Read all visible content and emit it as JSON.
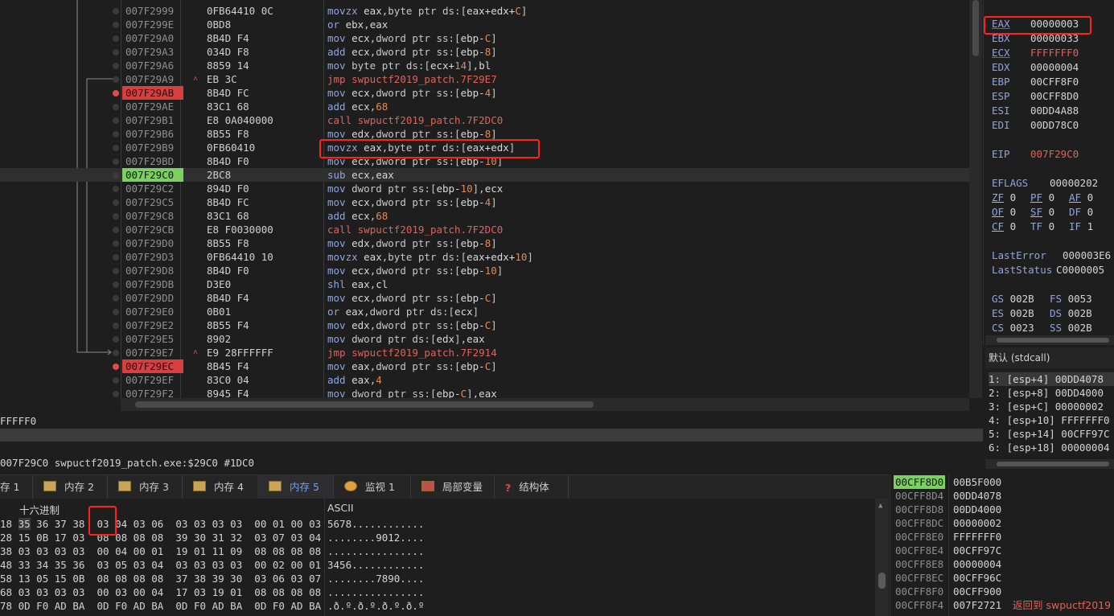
{
  "disasm": {
    "rows": [
      {
        "addr": "007F2999",
        "bytes": "0FB64410 0C",
        "mn": "movzx",
        "ops": [
          [
            "reg",
            "eax"
          ],
          [
            "t",
            ","
          ],
          [
            "t",
            "byte ptr "
          ],
          [
            "t",
            "ds:["
          ],
          [
            "reg",
            "eax+edx+"
          ],
          [
            "num",
            "C"
          ],
          [
            "t",
            "]"
          ]
        ]
      },
      {
        "addr": "007F299E",
        "bytes": "0BD8",
        "mn": "or",
        "ops": [
          [
            "reg",
            "ebx"
          ],
          [
            "t",
            ","
          ],
          [
            "reg",
            "eax"
          ]
        ]
      },
      {
        "addr": "007F29A0",
        "bytes": "8B4D F4",
        "mn": "mov",
        "ops": [
          [
            "reg",
            "ecx"
          ],
          [
            "t",
            ",dword ptr ss:["
          ],
          [
            "reg",
            "ebp-"
          ],
          [
            "num",
            "C"
          ],
          [
            "t",
            "]"
          ]
        ]
      },
      {
        "addr": "007F29A3",
        "bytes": "034D F8",
        "mn": "add",
        "ops": [
          [
            "reg",
            "ecx"
          ],
          [
            "t",
            ",dword ptr ss:["
          ],
          [
            "reg",
            "ebp-"
          ],
          [
            "num",
            "8"
          ],
          [
            "t",
            "]"
          ]
        ]
      },
      {
        "addr": "007F29A6",
        "bytes": "8859 14",
        "mn": "mov",
        "ops": [
          [
            "t",
            "byte ptr ds:["
          ],
          [
            "reg",
            "ecx+"
          ],
          [
            "num",
            "14"
          ],
          [
            "t",
            "],"
          ],
          [
            "reg",
            "bl"
          ]
        ]
      },
      {
        "addr": "007F29A9",
        "bytes": "EB 3C",
        "mn": "jmp",
        "ops": [
          [
            "call",
            "swpuctf2019_patch.7F29E7"
          ]
        ]
      },
      {
        "addr": "007F29AB",
        "bytes": "8B4D FC",
        "mn": "mov",
        "ops": [
          [
            "reg",
            "ecx"
          ],
          [
            "t",
            ",dword ptr ss:["
          ],
          [
            "reg",
            "ebp-"
          ],
          [
            "num",
            "4"
          ],
          [
            "t",
            "]"
          ]
        ]
      },
      {
        "addr": "007F29AE",
        "bytes": "83C1 68",
        "mn": "add",
        "ops": [
          [
            "reg",
            "ecx"
          ],
          [
            "t",
            ","
          ],
          [
            "num",
            "68"
          ]
        ]
      },
      {
        "addr": "007F29B1",
        "bytes": "E8 0A040000",
        "mn": "call",
        "ops": [
          [
            "call",
            "swpuctf2019_patch.7F2DC0"
          ]
        ]
      },
      {
        "addr": "007F29B6",
        "bytes": "8B55 F8",
        "mn": "mov",
        "ops": [
          [
            "reg",
            "edx"
          ],
          [
            "t",
            ",dword ptr ss:["
          ],
          [
            "reg",
            "ebp-"
          ],
          [
            "num",
            "8"
          ],
          [
            "t",
            "]"
          ]
        ]
      },
      {
        "addr": "007F29B9",
        "bytes": "0FB60410",
        "mn": "movzx",
        "ops": [
          [
            "reg",
            "eax"
          ],
          [
            "t",
            ",byte ptr ds:["
          ],
          [
            "reg",
            "eax+edx"
          ],
          [
            "t",
            "]"
          ]
        ]
      },
      {
        "addr": "007F29BD",
        "bytes": "8B4D F0",
        "mn": "mov",
        "ops": [
          [
            "reg",
            "ecx"
          ],
          [
            "t",
            ",dword ptr ss:["
          ],
          [
            "reg",
            "ebp-"
          ],
          [
            "num",
            "10"
          ],
          [
            "t",
            "]"
          ]
        ]
      },
      {
        "addr": "007F29C0",
        "bytes": "2BC8",
        "mn": "sub",
        "ops": [
          [
            "reg",
            "ecx"
          ],
          [
            "t",
            ","
          ],
          [
            "reg",
            "eax"
          ]
        ]
      },
      {
        "addr": "007F29C2",
        "bytes": "894D F0",
        "mn": "mov",
        "ops": [
          [
            "t",
            "dword ptr ss:["
          ],
          [
            "reg",
            "ebp-"
          ],
          [
            "num",
            "10"
          ],
          [
            "t",
            "],"
          ],
          [
            "reg",
            "ecx"
          ]
        ]
      },
      {
        "addr": "007F29C5",
        "bytes": "8B4D FC",
        "mn": "mov",
        "ops": [
          [
            "reg",
            "ecx"
          ],
          [
            "t",
            ",dword ptr ss:["
          ],
          [
            "reg",
            "ebp-"
          ],
          [
            "num",
            "4"
          ],
          [
            "t",
            "]"
          ]
        ]
      },
      {
        "addr": "007F29C8",
        "bytes": "83C1 68",
        "mn": "add",
        "ops": [
          [
            "reg",
            "ecx"
          ],
          [
            "t",
            ","
          ],
          [
            "num",
            "68"
          ]
        ]
      },
      {
        "addr": "007F29CB",
        "bytes": "E8 F0030000",
        "mn": "call",
        "ops": [
          [
            "call",
            "swpuctf2019_patch.7F2DC0"
          ]
        ]
      },
      {
        "addr": "007F29D0",
        "bytes": "8B55 F8",
        "mn": "mov",
        "ops": [
          [
            "reg",
            "edx"
          ],
          [
            "t",
            ",dword ptr ss:["
          ],
          [
            "reg",
            "ebp-"
          ],
          [
            "num",
            "8"
          ],
          [
            "t",
            "]"
          ]
        ]
      },
      {
        "addr": "007F29D3",
        "bytes": "0FB64410 10",
        "mn": "movzx",
        "ops": [
          [
            "reg",
            "eax"
          ],
          [
            "t",
            ",byte ptr ds:["
          ],
          [
            "reg",
            "eax+edx+"
          ],
          [
            "num",
            "10"
          ],
          [
            "t",
            "]"
          ]
        ]
      },
      {
        "addr": "007F29D8",
        "bytes": "8B4D F0",
        "mn": "mov",
        "ops": [
          [
            "reg",
            "ecx"
          ],
          [
            "t",
            ",dword ptr ss:["
          ],
          [
            "reg",
            "ebp-"
          ],
          [
            "num",
            "10"
          ],
          [
            "t",
            "]"
          ]
        ]
      },
      {
        "addr": "007F29DB",
        "bytes": "D3E0",
        "mn": "shl",
        "ops": [
          [
            "reg",
            "eax"
          ],
          [
            "t",
            ","
          ],
          [
            "reg",
            "cl"
          ]
        ]
      },
      {
        "addr": "007F29DD",
        "bytes": "8B4D F4",
        "mn": "mov",
        "ops": [
          [
            "reg",
            "ecx"
          ],
          [
            "t",
            ",dword ptr ss:["
          ],
          [
            "reg",
            "ebp-"
          ],
          [
            "num",
            "C"
          ],
          [
            "t",
            "]"
          ]
        ]
      },
      {
        "addr": "007F29E0",
        "bytes": "0B01",
        "mn": "or",
        "ops": [
          [
            "reg",
            "eax"
          ],
          [
            "t",
            ",dword ptr ds:["
          ],
          [
            "reg",
            "ecx"
          ],
          [
            "t",
            "]"
          ]
        ]
      },
      {
        "addr": "007F29E2",
        "bytes": "8B55 F4",
        "mn": "mov",
        "ops": [
          [
            "reg",
            "edx"
          ],
          [
            "t",
            ",dword ptr ss:["
          ],
          [
            "reg",
            "ebp-"
          ],
          [
            "num",
            "C"
          ],
          [
            "t",
            "]"
          ]
        ]
      },
      {
        "addr": "007F29E5",
        "bytes": "8902",
        "mn": "mov",
        "ops": [
          [
            "t",
            "dword ptr ds:["
          ],
          [
            "reg",
            "edx"
          ],
          [
            "t",
            "],"
          ],
          [
            "reg",
            "eax"
          ]
        ]
      },
      {
        "addr": "007F29E7",
        "bytes": "E9 28FFFFFF",
        "mn": "jmp",
        "ops": [
          [
            "call",
            "swpuctf2019_patch.7F2914"
          ]
        ]
      },
      {
        "addr": "007F29EC",
        "bytes": "8B45 F4",
        "mn": "mov",
        "ops": [
          [
            "reg",
            "eax"
          ],
          [
            "t",
            ",dword ptr ss:["
          ],
          [
            "reg",
            "ebp-"
          ],
          [
            "num",
            "C"
          ],
          [
            "t",
            "]"
          ]
        ]
      },
      {
        "addr": "007F29EF",
        "bytes": "83C0 04",
        "mn": "add",
        "ops": [
          [
            "reg",
            "eax"
          ],
          [
            "t",
            ","
          ],
          [
            "num",
            "4"
          ]
        ]
      },
      {
        "addr": "007F29F2",
        "bytes": "8945 F4",
        "mn": "mov",
        "ops": [
          [
            "t",
            "dword ptr ss:["
          ],
          [
            "reg",
            "ebp-"
          ],
          [
            "num",
            "C"
          ],
          [
            "t",
            "],"
          ],
          [
            "reg",
            "eax"
          ]
        ]
      }
    ]
  },
  "registers": {
    "gp": [
      {
        "name": "EAX",
        "value": "00000003",
        "underline": true,
        "changed": false
      },
      {
        "name": "EBX",
        "value": "00000033",
        "underline": false,
        "changed": false
      },
      {
        "name": "ECX",
        "value": "FFFFFFF0",
        "underline": true,
        "changed": true
      },
      {
        "name": "EDX",
        "value": "00000004",
        "underline": false,
        "changed": false
      },
      {
        "name": "EBP",
        "value": "00CFF8F0",
        "underline": false,
        "changed": false
      },
      {
        "name": "ESP",
        "value": "00CFF8D0",
        "underline": false,
        "changed": false
      },
      {
        "name": "ESI",
        "value": "00DD4A88",
        "underline": false,
        "changed": false
      },
      {
        "name": "EDI",
        "value": "00DD78C0",
        "underline": false,
        "changed": false
      }
    ],
    "eip": {
      "name": "EIP",
      "value": "007F29C0"
    },
    "eflags": {
      "name": "EFLAGS",
      "value": "00000202"
    },
    "flags": [
      [
        {
          "n": "ZF",
          "v": "0",
          "u": true
        },
        {
          "n": "PF",
          "v": "0",
          "u": true
        },
        {
          "n": "AF",
          "v": "0",
          "u": true
        }
      ],
      [
        {
          "n": "OF",
          "v": "0",
          "u": true
        },
        {
          "n": "SF",
          "v": "0",
          "u": true
        },
        {
          "n": "DF",
          "v": "0",
          "u": false
        }
      ],
      [
        {
          "n": "CF",
          "v": "0",
          "u": true
        },
        {
          "n": "TF",
          "v": "0",
          "u": false
        },
        {
          "n": "IF",
          "v": "1",
          "u": false
        }
      ]
    ],
    "last_error": {
      "name": "LastError",
      "value": "000003E6"
    },
    "last_status": {
      "name": "LastStatus",
      "value": "C0000005"
    },
    "segs": [
      [
        {
          "n": "GS",
          "v": "002B"
        },
        {
          "n": "FS",
          "v": "0053"
        }
      ],
      [
        {
          "n": "ES",
          "v": "002B"
        },
        {
          "n": "DS",
          "v": "002B"
        }
      ],
      [
        {
          "n": "CS",
          "v": "0023"
        },
        {
          "n": "SS",
          "v": "002B"
        }
      ]
    ]
  },
  "callconv": {
    "label": "默认 (stdcall)"
  },
  "stack_args": [
    "1: [esp+4] 00DD4078",
    "2: [esp+8] 00DD4000",
    "3: [esp+C] 00000002",
    "4: [esp+10] FFFFFFF0",
    "5: [esp+14] 00CFF97C",
    "6: [esp+18] 00000004"
  ],
  "infobar": {
    "line1": "FFFFF0",
    "line2": "007F29C0 swpuctf2019_patch.exe:$29C0 #1DC0"
  },
  "tabs": [
    {
      "label": "存 1",
      "icon": "memory-icon",
      "active": false
    },
    {
      "label": "内存 2",
      "icon": "memory-icon",
      "active": false
    },
    {
      "label": "内存 3",
      "icon": "memory-icon",
      "active": false
    },
    {
      "label": "内存 4",
      "icon": "memory-icon",
      "active": false
    },
    {
      "label": "内存 5",
      "icon": "memory-icon",
      "active": true
    },
    {
      "label": "监视 1",
      "icon": "watch-icon",
      "active": false
    },
    {
      "label": "局部变量",
      "icon": "locals-icon",
      "active": false
    },
    {
      "label": "结构体",
      "icon": "struct-icon",
      "active": false
    }
  ],
  "dump": {
    "hex_header": "十六进制",
    "ascii_header": "ASCII",
    "rows": [
      {
        "addr": "18",
        "hex": "35 36 37 38 03 04 03 06 03 03 03 03 00 01 00 03",
        "ascii": "5678............"
      },
      {
        "addr": "28",
        "hex": "15 0B 17 03 08 08 08 08 39 30 31 32 03 07 03 04",
        "ascii": "........9012...."
      },
      {
        "addr": "38",
        "hex": "03 03 03 03 00 04 00 01 19 01 11 09 08 08 08 08",
        "ascii": "................"
      },
      {
        "addr": "48",
        "hex": "33 34 35 36 03 05 03 04 03 03 03 03 00 02 00 01",
        "ascii": "3456............"
      },
      {
        "addr": "58",
        "hex": "13 05 15 0B 08 08 08 08 37 38 39 30 03 06 03 07",
        "ascii": "........7890...."
      },
      {
        "addr": "68",
        "hex": "03 03 03 03 00 03 00 04 17 03 19 01 08 08 08 08",
        "ascii": "................"
      },
      {
        "addr": "78",
        "hex": "0D F0 AD BA 0D F0 AD BA 0D F0 AD BA 0D F0 AD BA",
        "ascii": ".ð.º.ð.º.ð.º.ð.º"
      }
    ]
  },
  "stack": {
    "rows": [
      {
        "addr": "00CFF8D0",
        "val": "00B5F000",
        "comment": "",
        "top": true
      },
      {
        "addr": "00CFF8D4",
        "val": "00DD4078",
        "comment": "",
        "top": false
      },
      {
        "addr": "00CFF8D8",
        "val": "00DD4000",
        "comment": "",
        "top": false
      },
      {
        "addr": "00CFF8DC",
        "val": "00000002",
        "comment": "",
        "top": false
      },
      {
        "addr": "00CFF8E0",
        "val": "FFFFFFF0",
        "comment": "",
        "top": false
      },
      {
        "addr": "00CFF8E4",
        "val": "00CFF97C",
        "comment": "",
        "top": false
      },
      {
        "addr": "00CFF8E8",
        "val": "00000004",
        "comment": "",
        "top": false
      },
      {
        "addr": "00CFF8EC",
        "val": "00CFF96C",
        "comment": "",
        "top": false
      },
      {
        "addr": "00CFF8F0",
        "val": "00CFF900",
        "comment": "",
        "top": false
      },
      {
        "addr": "00CFF8F4",
        "val": "007F2721",
        "comment": "返回到 swpuctf2019",
        "top": false
      }
    ]
  },
  "colors": {
    "breakpoint": "#d84040",
    "eip": "#7cd062",
    "highlight_box": "#ff2020",
    "active_tab": "#6ea0f0"
  }
}
